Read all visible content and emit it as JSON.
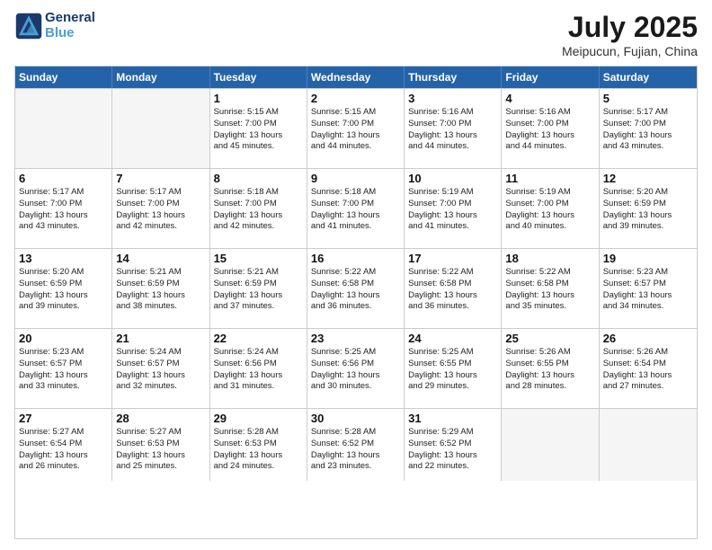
{
  "header": {
    "logo_line1": "General",
    "logo_line2": "Blue",
    "month_year": "July 2025",
    "location": "Meipucun, Fujian, China"
  },
  "weekdays": [
    "Sunday",
    "Monday",
    "Tuesday",
    "Wednesday",
    "Thursday",
    "Friday",
    "Saturday"
  ],
  "weeks": [
    [
      {
        "day": "",
        "empty": true
      },
      {
        "day": "",
        "empty": true
      },
      {
        "day": "1",
        "sunrise": "5:15 AM",
        "sunset": "7:00 PM",
        "daylight": "13 hours and 45 minutes."
      },
      {
        "day": "2",
        "sunrise": "5:15 AM",
        "sunset": "7:00 PM",
        "daylight": "13 hours and 44 minutes."
      },
      {
        "day": "3",
        "sunrise": "5:16 AM",
        "sunset": "7:00 PM",
        "daylight": "13 hours and 44 minutes."
      },
      {
        "day": "4",
        "sunrise": "5:16 AM",
        "sunset": "7:00 PM",
        "daylight": "13 hours and 44 minutes."
      },
      {
        "day": "5",
        "sunrise": "5:17 AM",
        "sunset": "7:00 PM",
        "daylight": "13 hours and 43 minutes."
      }
    ],
    [
      {
        "day": "6",
        "sunrise": "5:17 AM",
        "sunset": "7:00 PM",
        "daylight": "13 hours and 43 minutes."
      },
      {
        "day": "7",
        "sunrise": "5:17 AM",
        "sunset": "7:00 PM",
        "daylight": "13 hours and 42 minutes."
      },
      {
        "day": "8",
        "sunrise": "5:18 AM",
        "sunset": "7:00 PM",
        "daylight": "13 hours and 42 minutes."
      },
      {
        "day": "9",
        "sunrise": "5:18 AM",
        "sunset": "7:00 PM",
        "daylight": "13 hours and 41 minutes."
      },
      {
        "day": "10",
        "sunrise": "5:19 AM",
        "sunset": "7:00 PM",
        "daylight": "13 hours and 41 minutes."
      },
      {
        "day": "11",
        "sunrise": "5:19 AM",
        "sunset": "7:00 PM",
        "daylight": "13 hours and 40 minutes."
      },
      {
        "day": "12",
        "sunrise": "5:20 AM",
        "sunset": "6:59 PM",
        "daylight": "13 hours and 39 minutes."
      }
    ],
    [
      {
        "day": "13",
        "sunrise": "5:20 AM",
        "sunset": "6:59 PM",
        "daylight": "13 hours and 39 minutes."
      },
      {
        "day": "14",
        "sunrise": "5:21 AM",
        "sunset": "6:59 PM",
        "daylight": "13 hours and 38 minutes."
      },
      {
        "day": "15",
        "sunrise": "5:21 AM",
        "sunset": "6:59 PM",
        "daylight": "13 hours and 37 minutes."
      },
      {
        "day": "16",
        "sunrise": "5:22 AM",
        "sunset": "6:58 PM",
        "daylight": "13 hours and 36 minutes."
      },
      {
        "day": "17",
        "sunrise": "5:22 AM",
        "sunset": "6:58 PM",
        "daylight": "13 hours and 36 minutes."
      },
      {
        "day": "18",
        "sunrise": "5:22 AM",
        "sunset": "6:58 PM",
        "daylight": "13 hours and 35 minutes."
      },
      {
        "day": "19",
        "sunrise": "5:23 AM",
        "sunset": "6:57 PM",
        "daylight": "13 hours and 34 minutes."
      }
    ],
    [
      {
        "day": "20",
        "sunrise": "5:23 AM",
        "sunset": "6:57 PM",
        "daylight": "13 hours and 33 minutes."
      },
      {
        "day": "21",
        "sunrise": "5:24 AM",
        "sunset": "6:57 PM",
        "daylight": "13 hours and 32 minutes."
      },
      {
        "day": "22",
        "sunrise": "5:24 AM",
        "sunset": "6:56 PM",
        "daylight": "13 hours and 31 minutes."
      },
      {
        "day": "23",
        "sunrise": "5:25 AM",
        "sunset": "6:56 PM",
        "daylight": "13 hours and 30 minutes."
      },
      {
        "day": "24",
        "sunrise": "5:25 AM",
        "sunset": "6:55 PM",
        "daylight": "13 hours and 29 minutes."
      },
      {
        "day": "25",
        "sunrise": "5:26 AM",
        "sunset": "6:55 PM",
        "daylight": "13 hours and 28 minutes."
      },
      {
        "day": "26",
        "sunrise": "5:26 AM",
        "sunset": "6:54 PM",
        "daylight": "13 hours and 27 minutes."
      }
    ],
    [
      {
        "day": "27",
        "sunrise": "5:27 AM",
        "sunset": "6:54 PM",
        "daylight": "13 hours and 26 minutes."
      },
      {
        "day": "28",
        "sunrise": "5:27 AM",
        "sunset": "6:53 PM",
        "daylight": "13 hours and 25 minutes."
      },
      {
        "day": "29",
        "sunrise": "5:28 AM",
        "sunset": "6:53 PM",
        "daylight": "13 hours and 24 minutes."
      },
      {
        "day": "30",
        "sunrise": "5:28 AM",
        "sunset": "6:52 PM",
        "daylight": "13 hours and 23 minutes."
      },
      {
        "day": "31",
        "sunrise": "5:29 AM",
        "sunset": "6:52 PM",
        "daylight": "13 hours and 22 minutes."
      },
      {
        "day": "",
        "empty": true
      },
      {
        "day": "",
        "empty": true
      }
    ]
  ],
  "labels": {
    "sunrise": "Sunrise:",
    "sunset": "Sunset:",
    "daylight": "Daylight:"
  }
}
